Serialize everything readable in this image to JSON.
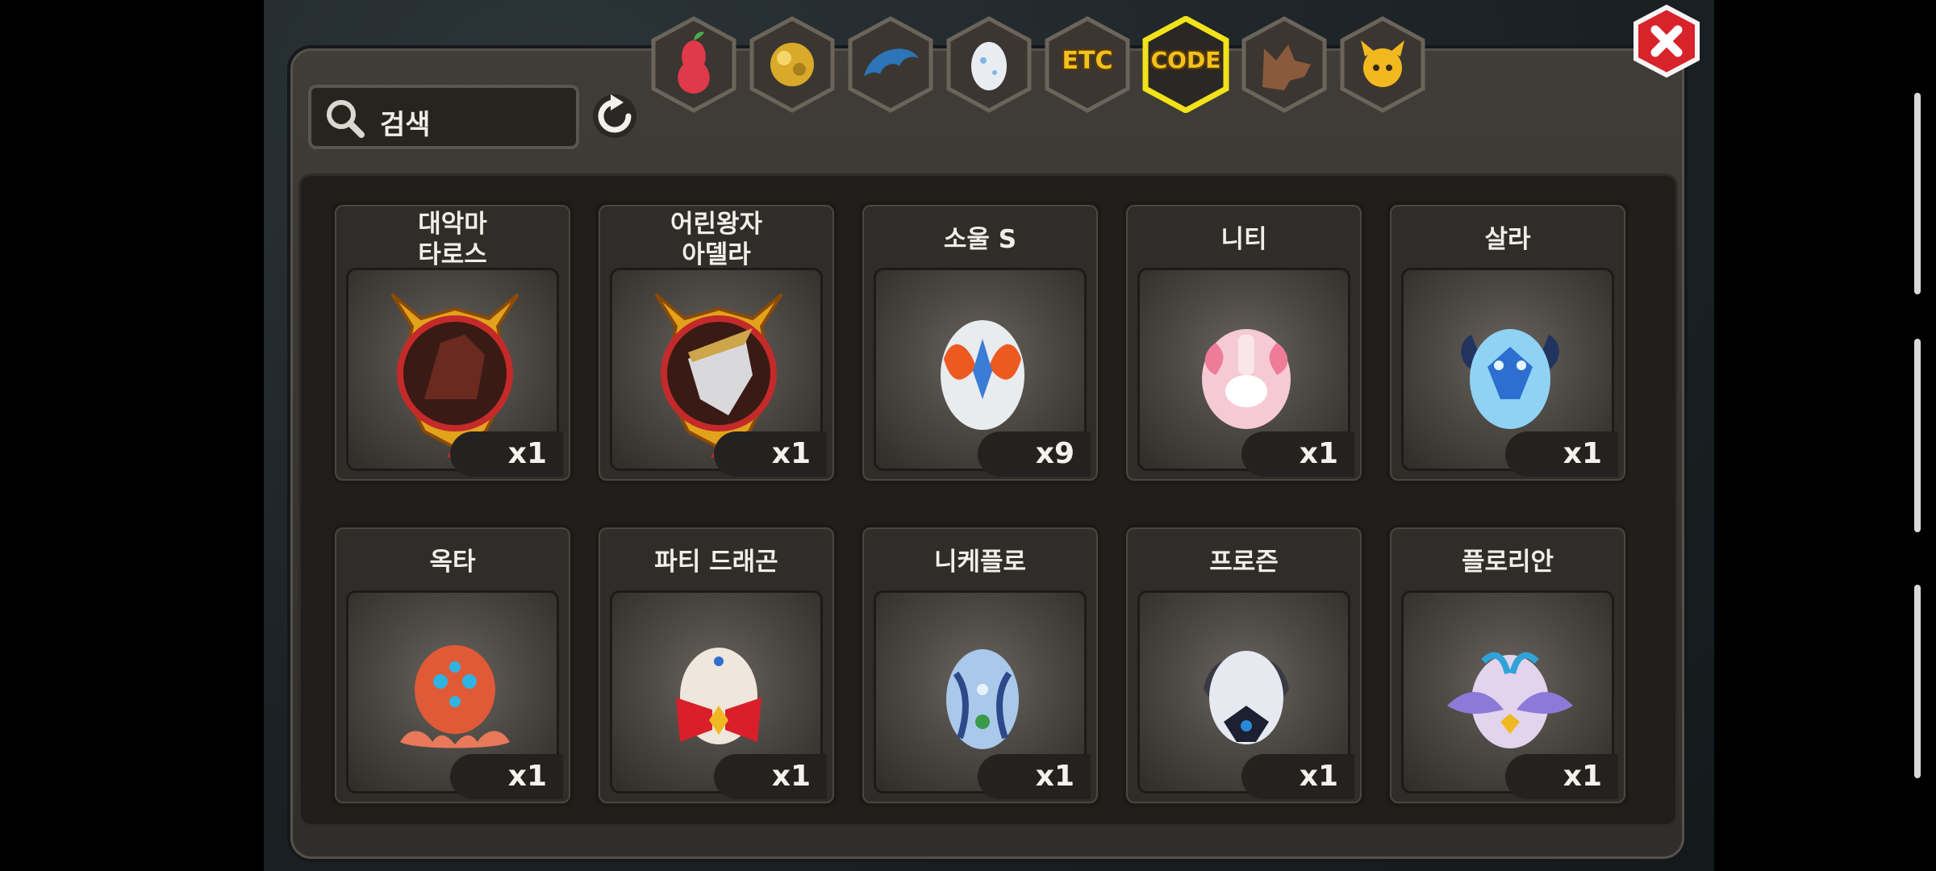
{
  "search": {
    "placeholder": "검색"
  },
  "tabs": [
    {
      "name": "tab-fruit",
      "label": "",
      "icon": "pear-icon",
      "selected": false
    },
    {
      "name": "tab-gold",
      "label": "",
      "icon": "gold-ore-icon",
      "selected": false
    },
    {
      "name": "tab-scale",
      "label": "",
      "icon": "dragon-scale-icon",
      "selected": false
    },
    {
      "name": "tab-egg",
      "label": "",
      "icon": "egg-icon",
      "selected": false
    },
    {
      "name": "tab-etc",
      "label": "ETC",
      "icon": "",
      "selected": false
    },
    {
      "name": "tab-code",
      "label": "CODE",
      "icon": "",
      "selected": true
    },
    {
      "name": "tab-wolf",
      "label": "",
      "icon": "wolf-head-icon",
      "selected": false
    },
    {
      "name": "tab-mascot",
      "label": "",
      "icon": "horned-cat-icon",
      "selected": false
    }
  ],
  "items": [
    {
      "name": "대악마\n타로스",
      "qty": "x1",
      "icon": "demon-medal-icon"
    },
    {
      "name": "어린왕자\n아델라",
      "qty": "x1",
      "icon": "prince-medal-icon"
    },
    {
      "name": "소울 S",
      "qty": "x9",
      "icon": "soul-egg-icon"
    },
    {
      "name": "니티",
      "qty": "x1",
      "icon": "pink-dragon-egg-icon"
    },
    {
      "name": "살라",
      "qty": "x1",
      "icon": "ice-dragon-egg-icon"
    },
    {
      "name": "옥타",
      "qty": "x1",
      "icon": "octopus-egg-icon"
    },
    {
      "name": "파티 드래곤",
      "qty": "x1",
      "icon": "ribbon-egg-icon"
    },
    {
      "name": "니케플로",
      "qty": "x1",
      "icon": "blue-egg-icon"
    },
    {
      "name": "프로즌",
      "qty": "x1",
      "icon": "frozen-egg-icon"
    },
    {
      "name": "플로리안",
      "qty": "x1",
      "icon": "winged-egg-icon"
    }
  ],
  "colors": {
    "accent_tab": "#f2d21a",
    "close_red": "#d8232a",
    "panel": "#3a3732"
  }
}
